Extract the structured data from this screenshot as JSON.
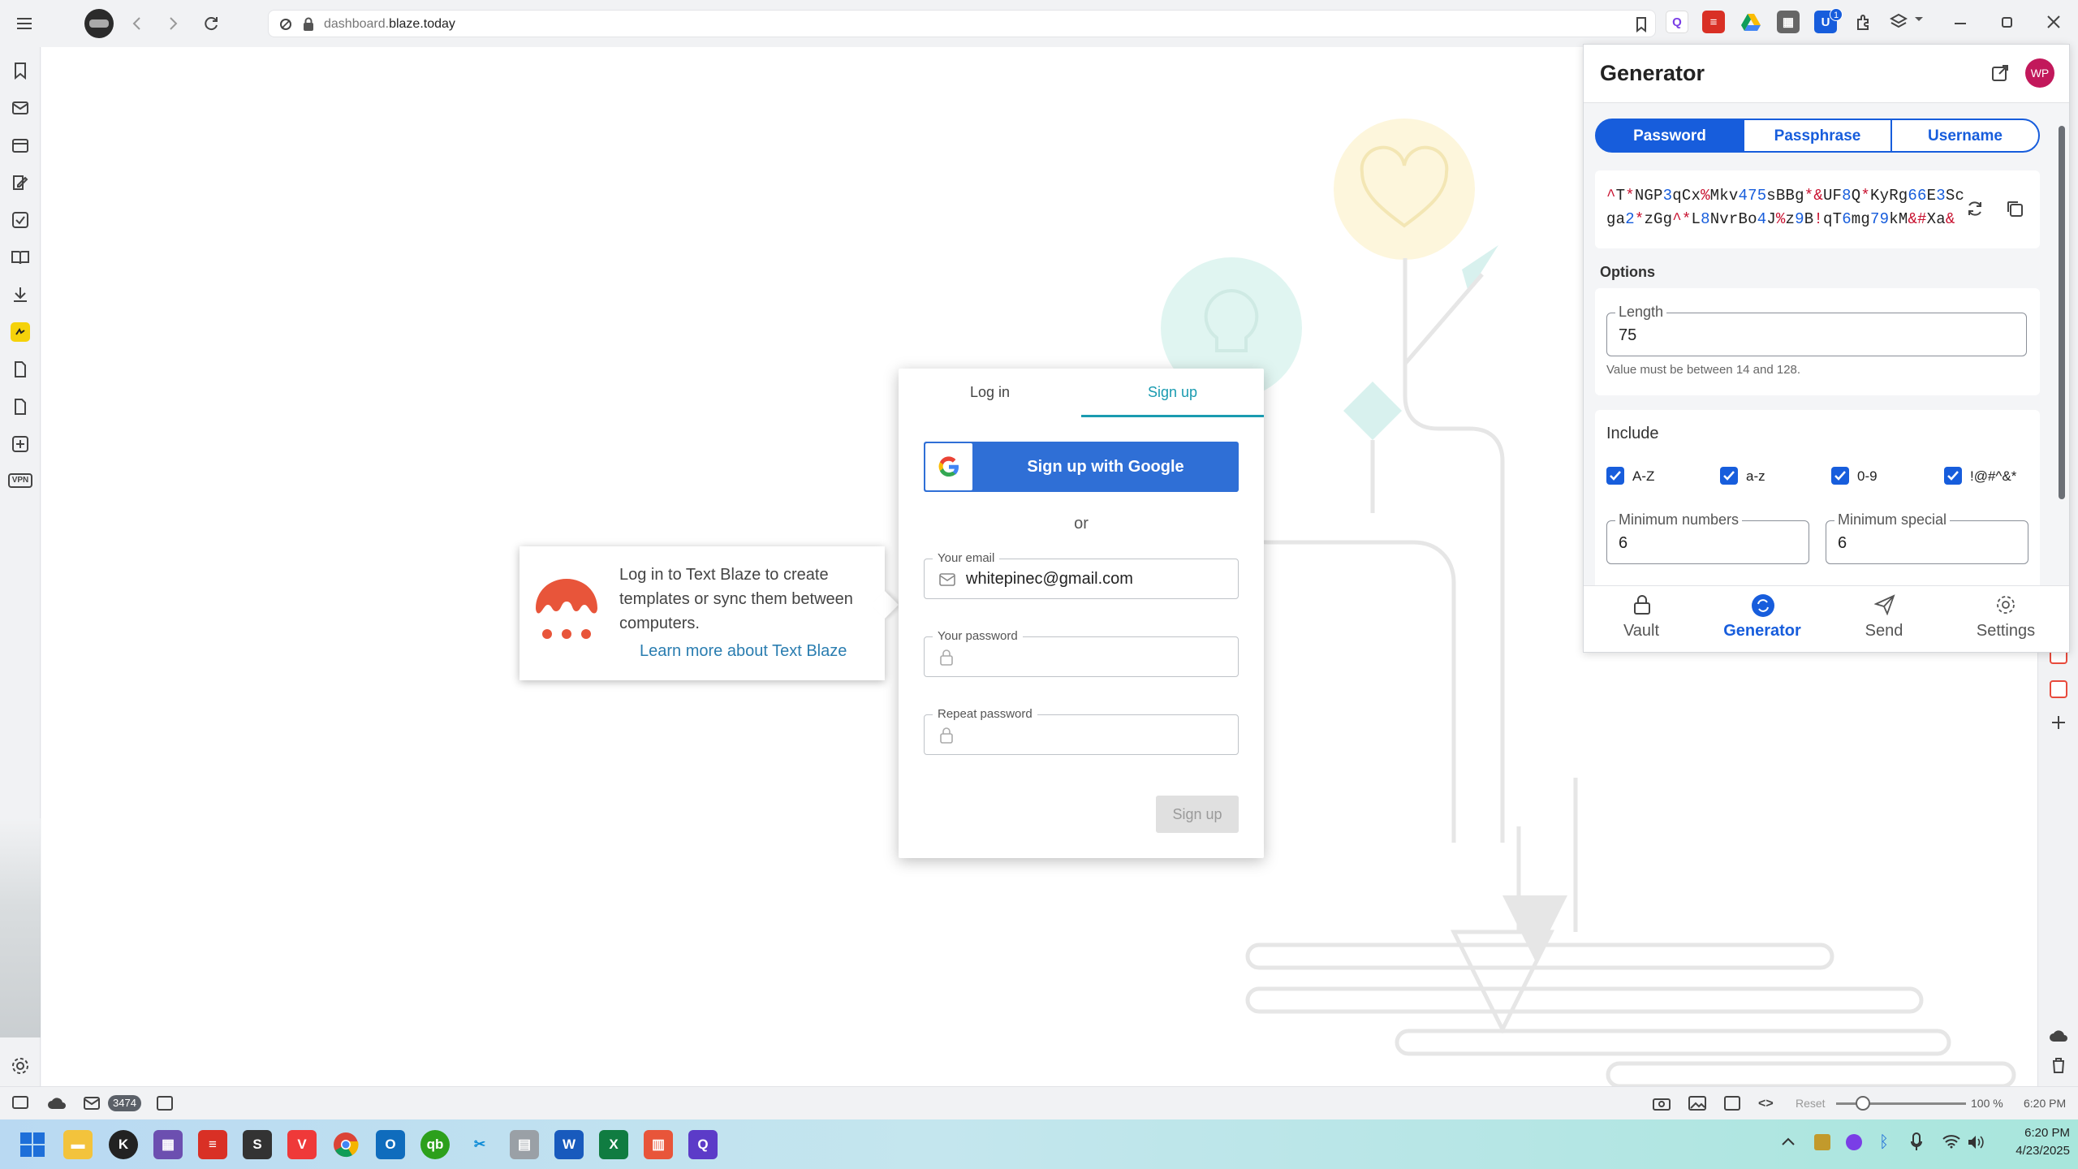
{
  "browser": {
    "url_domain_prefix": "dashboard.",
    "url_domain": "blaze.today",
    "extension_badge": "1"
  },
  "page": {
    "login_tab": "Log in",
    "signup_tab": "Sign up",
    "google_button": "Sign up with Google",
    "or_text": "or",
    "email_label": "Your email",
    "email_value": "whitepinec@gmail.com",
    "password_label": "Your password",
    "repeat_password_label": "Repeat password",
    "signup_button": "Sign up",
    "tooltip_text": "Log in to Text Blaze to create templates or sync them between computers.",
    "tooltip_link": "Learn more about Text Blaze"
  },
  "generator": {
    "title": "Generator",
    "avatar": "WP",
    "tabs": [
      "Password",
      "Passphrase",
      "Username"
    ],
    "password_line1": [
      {
        "t": "^",
        "c": "s"
      },
      {
        "t": "T",
        "c": "l"
      },
      {
        "t": "*",
        "c": "s"
      },
      {
        "t": "NGP",
        "c": "l"
      },
      {
        "t": "3",
        "c": "n"
      },
      {
        "t": "qCx",
        "c": "l"
      },
      {
        "t": "%",
        "c": "s"
      },
      {
        "t": "Mkv",
        "c": "l"
      },
      {
        "t": "475",
        "c": "n"
      },
      {
        "t": "sBBg",
        "c": "l"
      },
      {
        "t": "*&",
        "c": "s"
      },
      {
        "t": "UF",
        "c": "l"
      },
      {
        "t": "8",
        "c": "n"
      },
      {
        "t": "Q",
        "c": "l"
      },
      {
        "t": "*",
        "c": "s"
      },
      {
        "t": "KyRg",
        "c": "l"
      },
      {
        "t": "66",
        "c": "n"
      },
      {
        "t": "E",
        "c": "l"
      },
      {
        "t": "3",
        "c": "n"
      },
      {
        "t": "Sc",
        "c": "l"
      }
    ],
    "password_line2": [
      {
        "t": "ga",
        "c": "l"
      },
      {
        "t": "2",
        "c": "n"
      },
      {
        "t": "*",
        "c": "s"
      },
      {
        "t": "zGg",
        "c": "l"
      },
      {
        "t": "^*",
        "c": "s"
      },
      {
        "t": "L",
        "c": "l"
      },
      {
        "t": "8",
        "c": "n"
      },
      {
        "t": "NvrBo",
        "c": "l"
      },
      {
        "t": "4",
        "c": "n"
      },
      {
        "t": "J",
        "c": "l"
      },
      {
        "t": "%",
        "c": "s"
      },
      {
        "t": "z",
        "c": "l"
      },
      {
        "t": "9",
        "c": "n"
      },
      {
        "t": "B",
        "c": "l"
      },
      {
        "t": "!",
        "c": "s"
      },
      {
        "t": "qT",
        "c": "l"
      },
      {
        "t": "6",
        "c": "n"
      },
      {
        "t": "mg",
        "c": "l"
      },
      {
        "t": "79",
        "c": "n"
      },
      {
        "t": "kM",
        "c": "l"
      },
      {
        "t": "&#",
        "c": "s"
      },
      {
        "t": "Xa",
        "c": "l"
      },
      {
        "t": "&",
        "c": "s"
      }
    ],
    "options_label": "Options",
    "length_label": "Length",
    "length_value": "75",
    "length_hint": "Value must be between 14 and 128.",
    "include_label": "Include",
    "include": [
      "A-Z",
      "a-z",
      "0-9",
      "!@#^&*"
    ],
    "min_numbers_label": "Minimum numbers",
    "min_numbers_value": "6",
    "min_special_label": "Minimum special",
    "min_special_value": "6",
    "nav": [
      "Vault",
      "Generator",
      "Send",
      "Settings"
    ]
  },
  "status": {
    "mail_count": "3474",
    "reset_label": "Reset",
    "zoom": "100 %",
    "time": "6:20 PM"
  },
  "taskbar": {
    "time": "6:20 PM",
    "date": "4/23/2025"
  },
  "colors": {
    "accent": "#175ddc",
    "textblaze": "#e8553a",
    "signup_teal": "#1a9bb0"
  }
}
